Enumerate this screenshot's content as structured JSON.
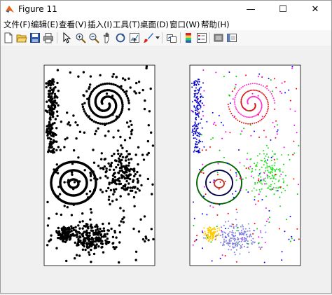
{
  "window": {
    "title": "Figure 11",
    "controls": {
      "minimize": "—",
      "maximize": "☐",
      "close": "✕"
    }
  },
  "menu": {
    "items": [
      "文件(F)",
      "编辑(E)",
      "查看(V)",
      "插入(I)",
      "工具(T)",
      "桌面(D)",
      "窗口(W)",
      "帮助(H)"
    ]
  },
  "toolbar": {
    "icons": [
      "new-figure-icon",
      "open-file-icon",
      "save-icon",
      "print-icon",
      "pointer-icon",
      "zoom-in-icon",
      "zoom-out-icon",
      "pan-icon",
      "rotate-3d-icon",
      "data-cursor-icon",
      "brush-icon",
      "link-plot-icon",
      "colorbar-icon",
      "legend-icon",
      "hide-plot-tools-icon",
      "show-plot-tools-icon"
    ]
  },
  "figure": {
    "panels": [
      {
        "name": "raw-data",
        "coloring": "all points black"
      },
      {
        "name": "clustered-data",
        "coloring": "points colored by cluster"
      }
    ],
    "colors": {
      "raw_points": "#000000",
      "cluster_strip": "#0000cc",
      "cluster_spiral_outer": "#dd1111",
      "cluster_spiral_inner": "#ff33cc",
      "cluster_green_scatter": "#22dd22",
      "cluster_ring_outer": "#006400",
      "cluster_ring_middle": "#000044",
      "cluster_ring_center": "#c0392b",
      "cluster_yellow": "#ffcc00",
      "cluster_lavender": "#8080e0",
      "noise_blue": "#0000ff",
      "noise_red": "#ff0000",
      "noise_green": "#00cc00",
      "noise_magenta": "#ff00ff"
    }
  }
}
